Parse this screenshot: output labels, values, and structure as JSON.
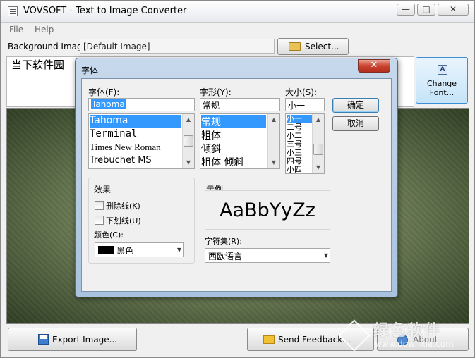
{
  "window": {
    "title": "VOVSOFT - Text to Image Converter",
    "controls": {
      "minimize": "—",
      "maximize": "□",
      "close": "✕"
    }
  },
  "menu": {
    "items": [
      "File",
      "Help"
    ]
  },
  "background": {
    "label": "Background Image:",
    "value": "[Default Image]",
    "select_button": "Select..."
  },
  "text_input": {
    "value": "当下软件园"
  },
  "change_font_button": "Change\nFont...",
  "bottom_buttons": {
    "export": "Export Image...",
    "feedback": "Send Feedback...",
    "about": "About"
  },
  "watermark": {
    "text": "绿色软件",
    "sub": "www.downxia.com"
  },
  "font_dialog": {
    "title": "字体",
    "close_symbol": "✕",
    "font": {
      "label": "字体(F):",
      "value": "Tahoma",
      "items": [
        "Tahoma",
        "Terminal",
        "Times New Roman",
        "Trebuchet MS"
      ],
      "selected": "Tahoma"
    },
    "style": {
      "label": "字形(Y):",
      "value": "常规",
      "items": [
        "常规",
        "粗体",
        "倾斜",
        "粗体 倾斜"
      ],
      "selected": "常规"
    },
    "size": {
      "label": "大小(S):",
      "value": "小一",
      "items": [
        "小一",
        "二号",
        "小二",
        "三号",
        "小三",
        "四号",
        "小四"
      ],
      "selected": "小一"
    },
    "ok_button": "确定",
    "cancel_button": "取消",
    "effects": {
      "label": "效果",
      "strikeout": "删除线(K)",
      "underline": "下划线(U)",
      "color_label": "颜色(C):",
      "color_value": "黑色",
      "color_hex": "#000000"
    },
    "sample": {
      "label": "示例",
      "text": "AaBbYyZz"
    },
    "charset": {
      "label": "字符集(R):",
      "value": "西欧语言"
    }
  }
}
